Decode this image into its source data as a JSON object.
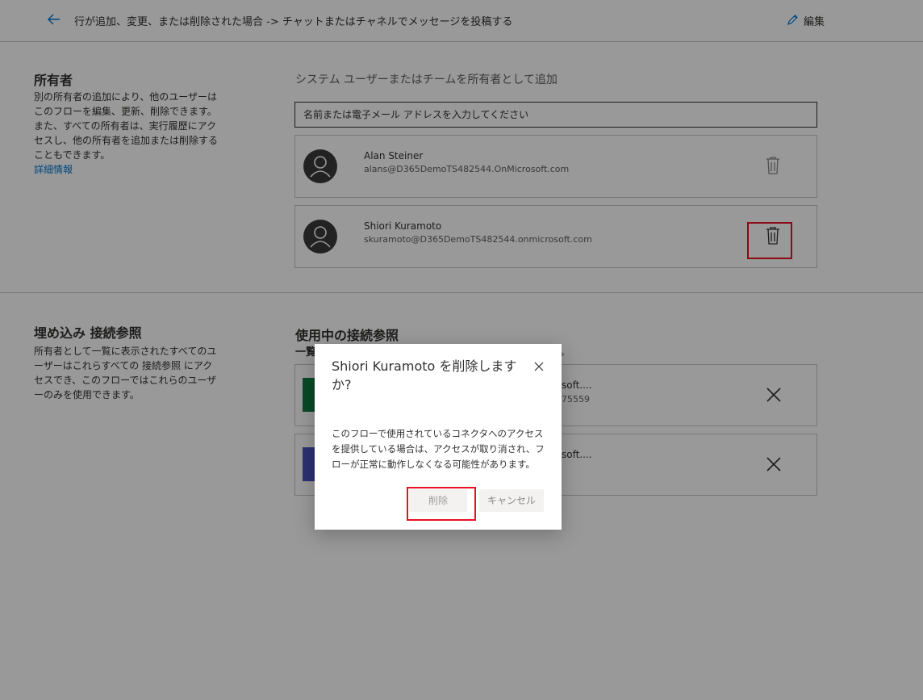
{
  "header": {
    "breadcrumb": "行が追加、変更、または削除された場合 -> チャットまたはチャネルでメッセージを投稿する",
    "edit_label": "編集"
  },
  "owners_section": {
    "title": "所有者",
    "description": "別の所有者の追加により、他のユーザーはこのフローを編集、更新、削除できます。また、すべての所有者は、実行履歴にアクセスし、他の所有者を追加または削除することもできます。",
    "learn_more": "詳細情報",
    "add_heading": "システム ユーザーまたはチームを所有者として追加",
    "input_placeholder": "名前または電子メール アドレスを入力してください",
    "owners": [
      {
        "name": "Alan Steiner",
        "email": "alans@D365DemoTS482544.OnMicrosoft.com"
      },
      {
        "name": "Shiori Kuramoto",
        "email": "skuramoto@D365DemoTS482544.onmicrosoft.com"
      }
    ]
  },
  "connections_section": {
    "title": "埋め込み 接続参照",
    "description": "所有者として一覧に表示されたすべてのユーザーはこれらすべての 接続参照 にアクセスでき、このフローではこれらのユーザーのみを使用できます。",
    "used_title": "使用中の接続参照",
    "used_subtitle_start": "一覧",
    "used_subtitle_end": "。",
    "connections": [
      {
        "name_tail": "soft....",
        "id_tail": "75559",
        "logo_color": "#107c41"
      },
      {
        "name_tail": "soft....",
        "id_tail": "",
        "logo_color": "#4b53bc"
      }
    ]
  },
  "dialog": {
    "title": "Shiori Kuramoto を削除しますか?",
    "body": "このフローで使用されているコネクタへのアクセスを提供している場合は、アクセスが取り消され、フローが正常に動作しなくなる可能性があります。",
    "delete_label": "削除",
    "cancel_label": "キャンセル"
  },
  "colors": {
    "accent": "#0078d4",
    "highlight": "#e81123"
  }
}
